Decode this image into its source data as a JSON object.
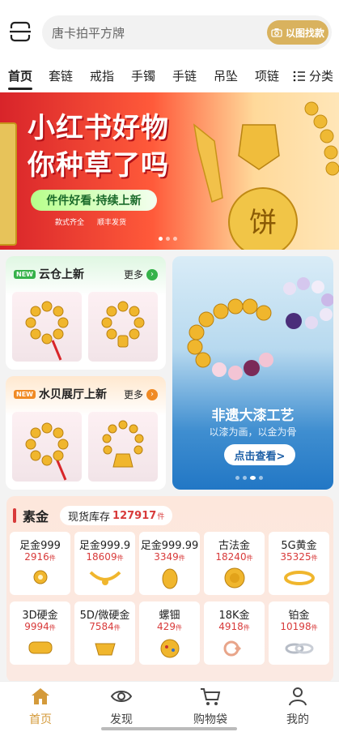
{
  "search": {
    "placeholder": "唐卡拍平方牌",
    "photo_button": "以图找款"
  },
  "categories": {
    "tabs": [
      "首页",
      "套链",
      "戒指",
      "手镯",
      "手链",
      "吊坠",
      "项链"
    ],
    "active_index": 0,
    "more_label": "分类"
  },
  "banner": {
    "title_line1": "小红书好物",
    "title_line2": "你种草了吗",
    "pill_text": "件件好看·持续上新",
    "tag1": "款式齐全",
    "tag2": "顺丰发货",
    "seal_char": "饼",
    "slide_count": 3,
    "active_slide": 0
  },
  "promo": {
    "cloud": {
      "badge": "NEW",
      "title": "云仓上新",
      "more": "更多"
    },
    "showroom": {
      "badge": "NEW",
      "title": "水贝展厅上新",
      "more": "更多"
    },
    "heritage": {
      "title": "非遗大漆工艺",
      "subtitle": "以漆为画，以金为骨",
      "button": "点击查看>",
      "slide_count": 4,
      "active_slide": 2
    }
  },
  "gold": {
    "title": "素金",
    "stock_label": "现货库存",
    "stock_value": "127917",
    "stock_unit": "件",
    "unit": "件",
    "items": [
      {
        "name": "足金999",
        "count": "2916"
      },
      {
        "name": "足金999.9",
        "count": "18609"
      },
      {
        "name": "足金999.99",
        "count": "3349"
      },
      {
        "name": "古法金",
        "count": "18240"
      },
      {
        "name": "5G黄金",
        "count": "35325"
      },
      {
        "name": "3D硬金",
        "count": "9994"
      },
      {
        "name": "5D/微硬金",
        "count": "7584"
      },
      {
        "name": "螺钿",
        "count": "429"
      },
      {
        "name": "18K金",
        "count": "4918"
      },
      {
        "name": "铂金",
        "count": "10198"
      }
    ]
  },
  "nav": {
    "items": [
      {
        "label": "首页",
        "icon": "home-icon"
      },
      {
        "label": "发现",
        "icon": "eye-icon"
      },
      {
        "label": "购物袋",
        "icon": "cart-icon"
      },
      {
        "label": "我的",
        "icon": "user-icon"
      }
    ],
    "active_index": 0
  },
  "colors": {
    "accent_gold": "#d9b25e",
    "price_red": "#d83a3a",
    "nav_active": "#d49a3a"
  }
}
